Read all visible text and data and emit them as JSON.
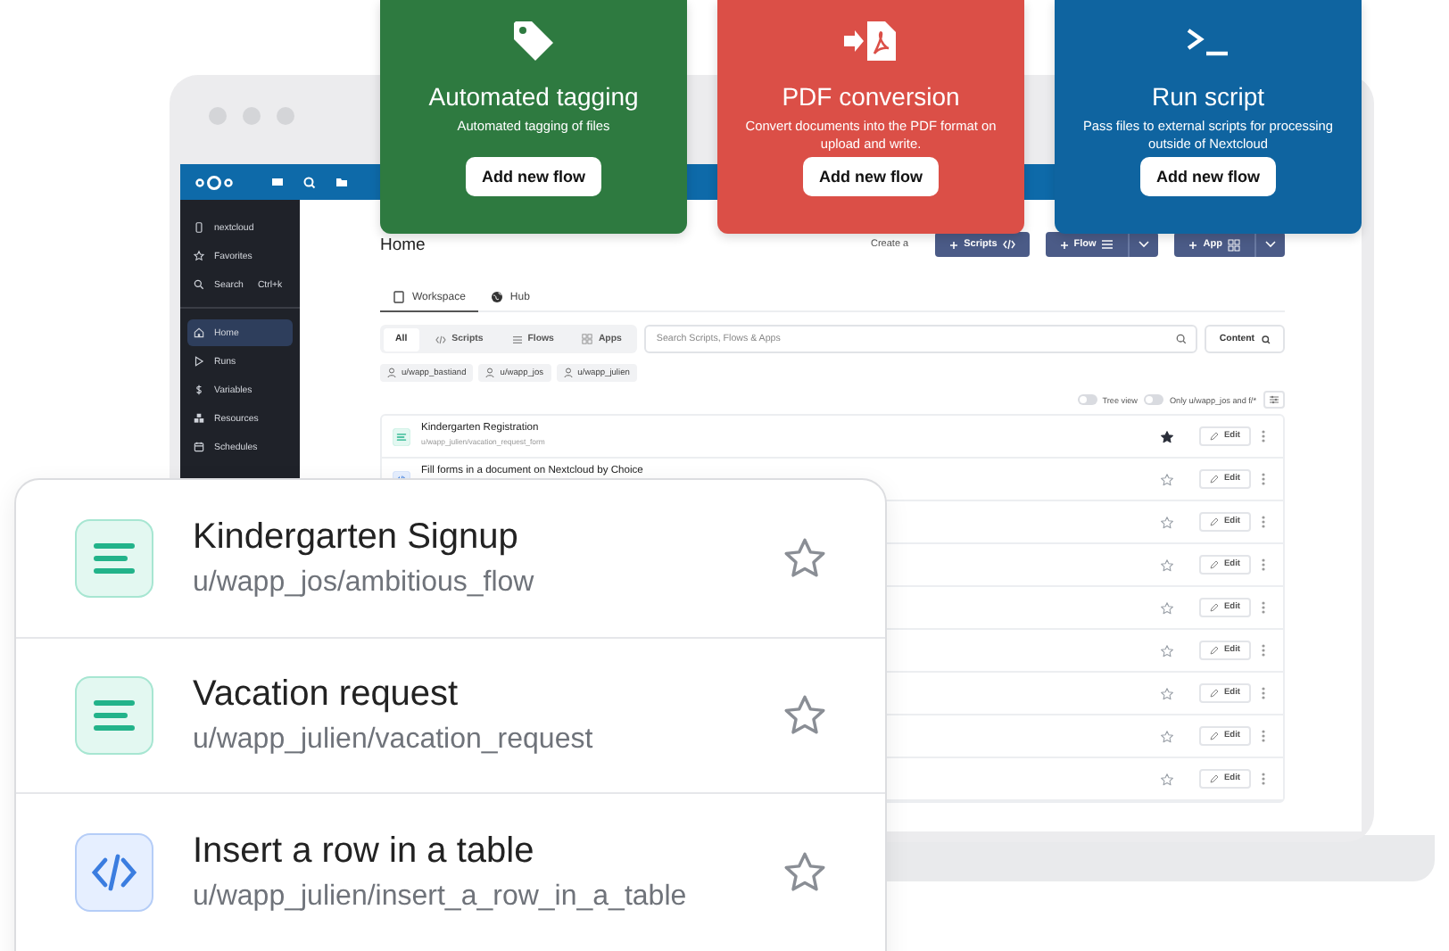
{
  "feature_cards": [
    {
      "kind": "tag",
      "title": "Automated tagging",
      "description": "Automated tagging of files",
      "button": "Add new flow",
      "color": "#2e7a40"
    },
    {
      "kind": "pdf",
      "title": "PDF conversion",
      "description": "Convert documents into the PDF format on upload and write.",
      "button": "Add new flow",
      "color": "#db4f47"
    },
    {
      "kind": "terminal",
      "title": "Run script",
      "description": "Pass files to external scripts for processing outside of Nextcloud",
      "button": "Add new flow",
      "color": "#0f64a0"
    }
  ],
  "sidebar": {
    "items": [
      {
        "kind": "device",
        "label": "nextcloud",
        "selected": false
      },
      {
        "kind": "star",
        "label": "Favorites",
        "selected": false
      },
      {
        "kind": "search",
        "label": "Search",
        "shortcut": "Ctrl+k",
        "selected": false
      },
      {
        "kind": "home",
        "label": "Home",
        "selected": true
      },
      {
        "kind": "play",
        "label": "Runs",
        "selected": false
      },
      {
        "kind": "dollar",
        "label": "Variables",
        "selected": false
      },
      {
        "kind": "boxes",
        "label": "Resources",
        "selected": false
      },
      {
        "kind": "calendar",
        "label": "Schedules",
        "selected": false
      }
    ]
  },
  "page": {
    "title": "Home",
    "create_label": "Create a",
    "create_buttons": [
      {
        "kind": "script",
        "label": "Scripts",
        "dropdown": false
      },
      {
        "kind": "flow",
        "label": "Flow",
        "dropdown": true
      },
      {
        "kind": "app",
        "label": "App",
        "dropdown": true
      }
    ],
    "tabs": [
      {
        "kind": "workspace",
        "label": "Workspace",
        "selected": true
      },
      {
        "kind": "hub",
        "label": "Hub",
        "selected": false
      }
    ],
    "filters": [
      {
        "kind": "all",
        "label": "All",
        "selected": true
      },
      {
        "kind": "script",
        "label": "Scripts",
        "selected": false
      },
      {
        "kind": "flow",
        "label": "Flows",
        "selected": false
      },
      {
        "kind": "app",
        "label": "Apps",
        "selected": false
      }
    ],
    "search": {
      "placeholder": "Search Scripts, Flows & Apps"
    },
    "content_button": "Content",
    "owner_chips": [
      "u/wapp_bastiand",
      "u/wapp_jos",
      "u/wapp_julien"
    ],
    "toggles": [
      {
        "label": "Tree view",
        "on": false
      },
      {
        "label": "Only u/wapp_jos and f/*",
        "on": false
      }
    ],
    "rows": [
      {
        "kind": "flow",
        "title": "Kindergarten Registration",
        "path": "u/wapp_julien/vacation_request_form",
        "starred": true,
        "edit": "Edit"
      },
      {
        "kind": "script",
        "title": "Fill forms in a document on Nextcloud by Choice",
        "starred": false,
        "edit": "Edit"
      },
      {
        "starred": false,
        "edit": "Edit"
      },
      {
        "starred": false,
        "edit": "Edit"
      },
      {
        "starred": false,
        "edit": "Edit"
      },
      {
        "starred": false,
        "edit": "Edit"
      },
      {
        "starred": false,
        "edit": "Edit"
      },
      {
        "starred": false,
        "edit": "Edit"
      },
      {
        "starred": false,
        "edit": "Edit"
      }
    ]
  },
  "favorites_panel": {
    "items": [
      {
        "kind": "flow",
        "title": "Kindergarten Signup",
        "path": "u/wapp_jos/ambitious_flow",
        "starred": false
      },
      {
        "kind": "flow",
        "title": "Vacation request",
        "path": "u/wapp_julien/vacation_request",
        "starred": false
      },
      {
        "kind": "script",
        "title": "Insert a row in a table",
        "path": "u/wapp_julien/insert_a_row_in_a_table",
        "starred": false
      }
    ]
  }
}
